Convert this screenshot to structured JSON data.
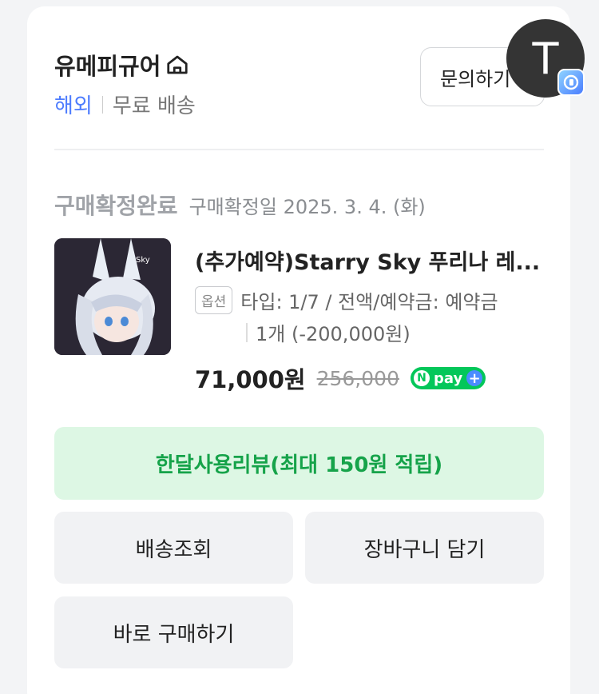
{
  "seller": {
    "name": "유메피규어",
    "tag_overseas": "해외",
    "tag_shipping": "무료 배송",
    "inquiry_label": "문의하기"
  },
  "order": {
    "status": "구매확정완료",
    "confirm_date": "구매확정일 2025. 3. 4. (화)"
  },
  "product": {
    "title": "(추가예약)Starry Sky 푸리나 레...",
    "option_badge": "옵션",
    "option_text": "타입: 1/7 / 전액/예약금: 예약금",
    "quantity_text": "1개 (-200,000원)",
    "price": "71,000원",
    "original_price": "256,000",
    "npay_label": "pay",
    "thumb_caption": "Sky"
  },
  "actions": {
    "review": "한달사용리뷰(최대 150원 적립)",
    "delivery": "배송조회",
    "cart": "장바구니 담기",
    "buy_now": "바로 구매하기"
  },
  "user": {
    "avatar_initial": "T"
  },
  "colors": {
    "accent_blue": "#4d7cfe",
    "review_green": "#16a34a",
    "review_bg": "#ddf7e4",
    "npay_green": "#03c75a"
  },
  "icons": [
    "home-icon",
    "npay-icon",
    "app-badge-icon"
  ]
}
